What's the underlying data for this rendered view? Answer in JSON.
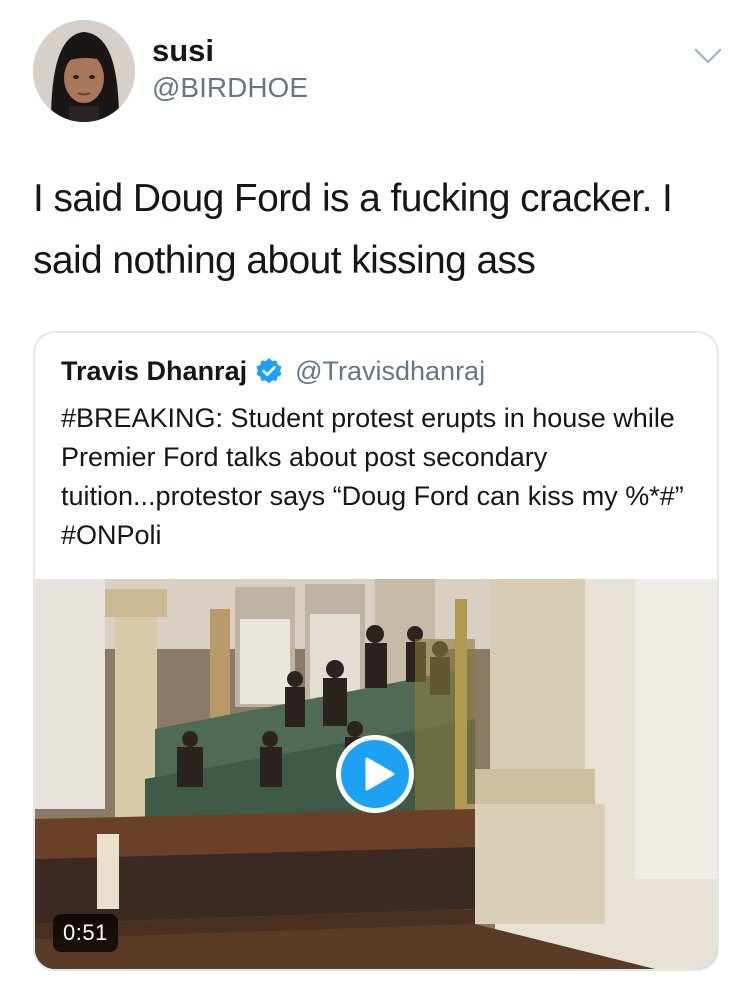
{
  "tweet": {
    "author": {
      "name": "susi",
      "handle": "@BIRDHOE"
    },
    "text": "I said Doug Ford is a fucking cracker. I said nothing about kissing ass",
    "menu_icon": "chevron-down-icon"
  },
  "quoted_tweet": {
    "author": {
      "name": "Travis Dhanraj",
      "handle": "@Travisdhanraj",
      "verified": true,
      "verified_icon": "verified-badge-icon"
    },
    "text": "#BREAKING: Student protest erupts in house while Premier Ford talks about post secondary tuition...protestor says “Doug Ford can kiss my %*#” #ONPoli",
    "media": {
      "type": "video",
      "duration": "0:51",
      "play_icon": "play-icon"
    }
  },
  "colors": {
    "text_primary": "#14171a",
    "text_secondary": "#657786",
    "accent": "#1da1f2",
    "border": "#e1e8ed"
  }
}
